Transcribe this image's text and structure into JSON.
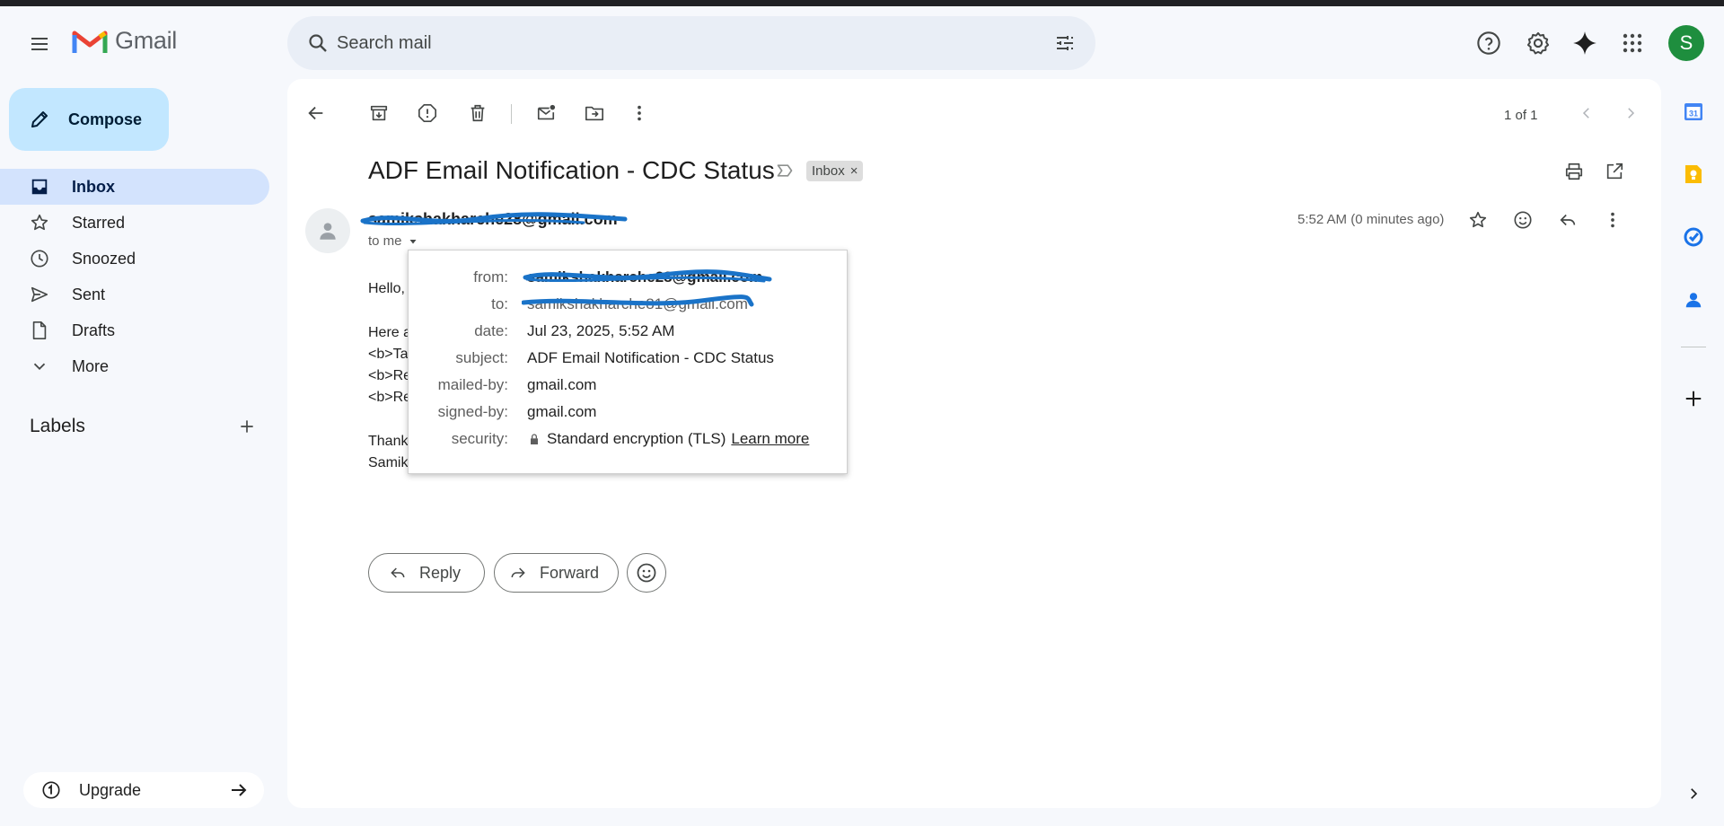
{
  "app": {
    "name": "Gmail",
    "account_initial": "S"
  },
  "search": {
    "placeholder": "Search mail"
  },
  "sidebar": {
    "compose_label": "Compose",
    "items": [
      {
        "label": "Inbox",
        "icon": "inbox-icon",
        "active": true
      },
      {
        "label": "Starred",
        "icon": "star-icon"
      },
      {
        "label": "Snoozed",
        "icon": "clock-icon"
      },
      {
        "label": "Sent",
        "icon": "send-icon"
      },
      {
        "label": "Drafts",
        "icon": "draft-icon"
      },
      {
        "label": "More",
        "icon": "chevron-down-icon"
      }
    ],
    "labels_title": "Labels",
    "upgrade_label": "Upgrade"
  },
  "toolbar": {
    "pager_text": "1 of 1"
  },
  "message": {
    "subject": "ADF Email Notification - CDC Status",
    "label_chip": "Inbox",
    "label_chip_close": "×",
    "sender_email": "samikshakharche28@gmail.com",
    "to_line": "to me",
    "time": "5:52 AM (0 minutes ago)",
    "body": {
      "greeting": "Hello,",
      "line1": "Here a",
      "line2": "<b>Ta",
      "line3": "<b>Re",
      "line4": "<b>Re",
      "thanks": "Thank",
      "signoff": "Samik"
    }
  },
  "details": {
    "from_key": "from:",
    "from_val": "samikshakharche28@gmail.com",
    "to_key": "to:",
    "to_val": "samikshakharche81@gmail.com",
    "date_key": "date:",
    "date_val": "Jul 23, 2025, 5:52 AM",
    "subject_key": "subject:",
    "subject_val": "ADF Email Notification - CDC Status",
    "mailed_key": "mailed-by:",
    "mailed_val": "gmail.com",
    "signed_key": "signed-by:",
    "signed_val": "gmail.com",
    "security_key": "security:",
    "security_val": "Standard encryption (TLS)",
    "learn_more": "Learn more"
  },
  "actions": {
    "reply_label": "Reply",
    "forward_label": "Forward"
  },
  "rail": {
    "calendar_day": "31"
  },
  "colors": {
    "accent_blue": "#0b57d0",
    "active_nav": "#d3e3fd",
    "compose_bg": "#c2e7ff",
    "avatar_green": "#1e8e3e",
    "scribble": "#1a73c8"
  }
}
